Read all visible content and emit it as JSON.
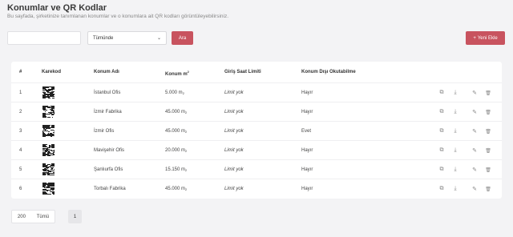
{
  "header": {
    "title": "Konumlar ve QR Kodlar",
    "subtitle": "Bu sayfada, şirketinize tanımlanan konumlar ve o konumlara ait QR kodları görüntüleyebilirsiniz."
  },
  "filters": {
    "search_value": "",
    "location_select": "Tümünde",
    "search_button": "Ara",
    "new_button": "Yeni Ekle"
  },
  "table": {
    "headers": {
      "index": "#",
      "qr": "Karekod",
      "name": "Konum Adı",
      "area": "Konum m",
      "area_sup": "2",
      "entry": "Giriş Saat Limiti",
      "outside": "Konum Dışı Okutabilme"
    },
    "rows": [
      {
        "index": "1",
        "name": "İstanbul Ofis",
        "area": "5.000 m",
        "entry": "Limit yok",
        "outside": "Hayır"
      },
      {
        "index": "2",
        "name": "İzmir Fabrika",
        "area": "45.000 m",
        "entry": "Limit yok",
        "outside": "Hayır"
      },
      {
        "index": "3",
        "name": "İzmir Ofis",
        "area": "45.000 m",
        "entry": "Limit yok",
        "outside": "Evet"
      },
      {
        "index": "4",
        "name": "Mavişehir Ofis",
        "area": "20.000 m",
        "entry": "Limit yok",
        "outside": "Hayır"
      },
      {
        "index": "5",
        "name": "Şanlıurfa Ofis",
        "area": "15.150 m",
        "entry": "Limit yok",
        "outside": "Hayır"
      },
      {
        "index": "6",
        "name": "Torbalı Fabrika",
        "area": "45.000 m",
        "entry": "Limit yok",
        "outside": "Hayır"
      }
    ],
    "area_sup": "2"
  },
  "pagination": {
    "size": "200",
    "size_label": "Tümü",
    "current_page": "1"
  },
  "colors": {
    "accent": "#c8535f",
    "background": "#f3f3f5"
  },
  "icons": [
    "external-link-icon",
    "download-icon",
    "edit-icon",
    "trash-icon",
    "plus-icon"
  ]
}
